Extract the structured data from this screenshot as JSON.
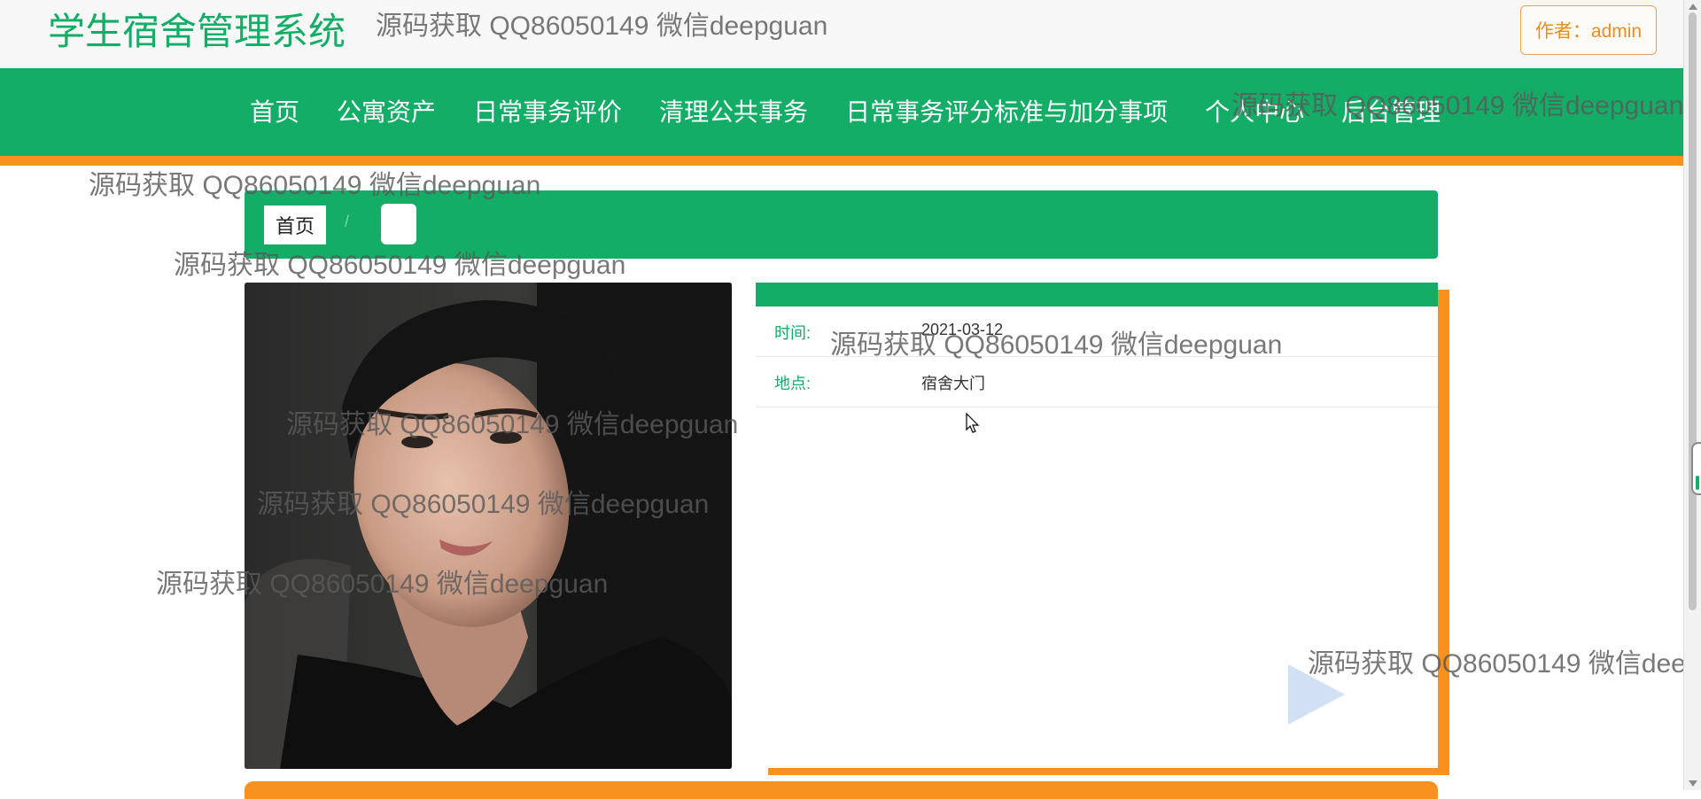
{
  "header": {
    "site_title": "学生宿舍管理系统",
    "author_button": "作者：admin"
  },
  "nav": {
    "items": [
      {
        "label": "首页"
      },
      {
        "label": "公寓资产"
      },
      {
        "label": "日常事务评价"
      },
      {
        "label": "清理公共事务"
      },
      {
        "label": "日常事务评分标准与加分事项"
      },
      {
        "label": "个人中心"
      },
      {
        "label": "后台管理"
      }
    ]
  },
  "breadcrumb": {
    "home": "首页",
    "separator": "/",
    "current": ""
  },
  "detail": {
    "rows": [
      {
        "label": "时间:",
        "value": "2021-03-12"
      },
      {
        "label": "地点:",
        "value": "宿舍大门"
      }
    ]
  },
  "watermark": "源码获取 QQ86050149 微信deepguan",
  "colors": {
    "primary_green": "#13ad67",
    "accent_orange": "#f8911e",
    "author_orange": "#f08b1d"
  }
}
